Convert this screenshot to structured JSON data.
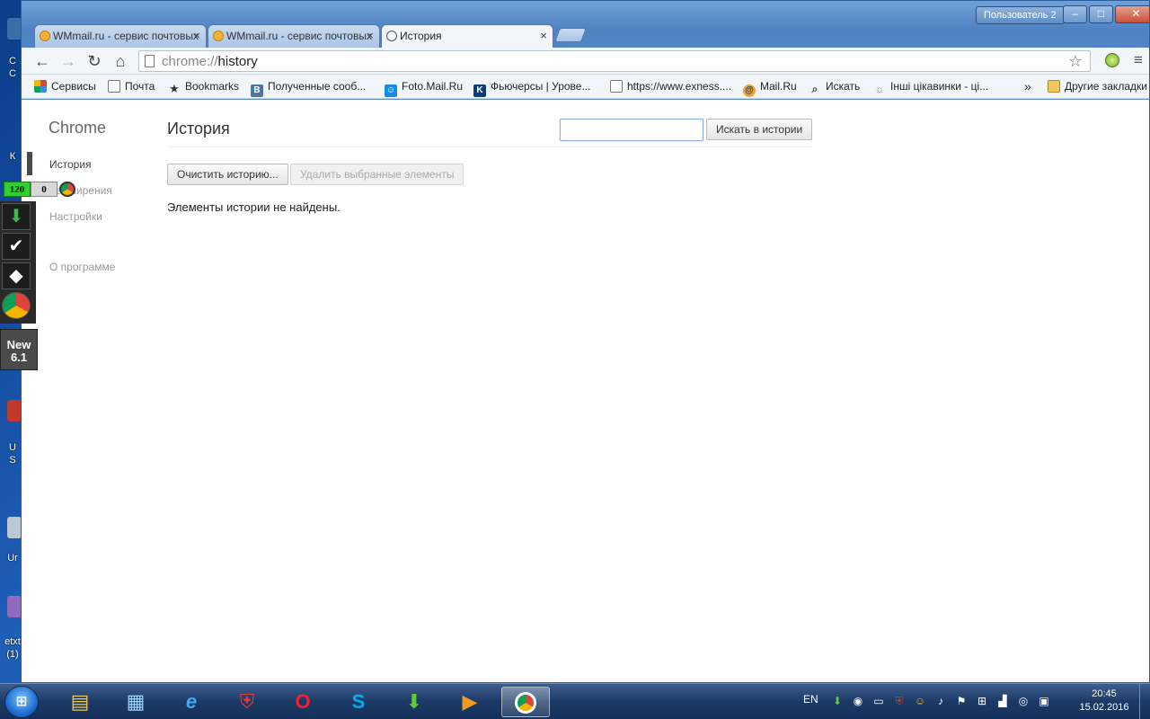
{
  "desktop": {
    "frag_letters": [
      "С",
      "С",
      "К"
    ],
    "frag_labels": [
      "U",
      "S",
      "Ur",
      "etxt",
      "(1)"
    ]
  },
  "window": {
    "user_badge": "Пользователь 2",
    "controls": {
      "minimize": "‒",
      "maximize": "□",
      "close": "✕"
    }
  },
  "tabs": [
    {
      "title": "WMmail.ru - сервис почтовых",
      "close": "×",
      "active": false
    },
    {
      "title": "WMmail.ru - сервис почтовых",
      "close": "×",
      "active": false
    },
    {
      "title": "История",
      "close": "×",
      "active": true
    }
  ],
  "toolbar": {
    "back": "←",
    "forward": "→",
    "reload": "↻",
    "home": "⌂",
    "url_scheme": "chrome://",
    "url_path": "history",
    "star": "☆",
    "menu": "≡"
  },
  "bookmarks": {
    "items": [
      {
        "label": "Сервисы",
        "icon": "apps-icon"
      },
      {
        "label": "Почта",
        "icon": "page-icon"
      },
      {
        "label": "Bookmarks",
        "icon": "star-icon"
      },
      {
        "label": "Полученные сооб...",
        "icon": "vk-icon"
      },
      {
        "label": "Foto.Mail.Ru",
        "icon": "foto-icon"
      },
      {
        "label": "Фьючерсы | Урове...",
        "icon": "k-icon"
      },
      {
        "label": "https://www.exness....",
        "icon": "page-icon"
      },
      {
        "label": "Mail.Ru",
        "icon": "mailru-icon"
      },
      {
        "label": "Искать",
        "icon": "search-icon"
      },
      {
        "label": "Інші цікавинки - ці...",
        "icon": "link-icon"
      }
    ],
    "overflow": "»",
    "other": "Другие закладки"
  },
  "sidebar": {
    "title": "Chrome",
    "items": [
      "История",
      "Расширения",
      "Настройки",
      "О программе"
    ]
  },
  "main": {
    "title": "История",
    "search_placeholder": "",
    "search_button": "Искать в истории",
    "clear_button": "Очистить историю...",
    "delete_button": "Удалить выбранные элементы",
    "empty_message": "Элементы истории не найдены."
  },
  "overlay": {
    "counter_green": "120",
    "counter_grey": "0",
    "new_label": "New",
    "version": "6.1"
  },
  "taskbar": {
    "start": "⊞",
    "apps": [
      "explorer",
      "control-panel",
      "internet-explorer",
      "antivirus",
      "opera",
      "skype",
      "downloader",
      "media-player",
      "chrome"
    ],
    "lang": "EN",
    "time": "20:45",
    "date": "15.02.2016"
  },
  "colors": {
    "accent": "#4f82c2",
    "counter_green": "#2fd12f",
    "taskbar": "#1d3a66"
  }
}
